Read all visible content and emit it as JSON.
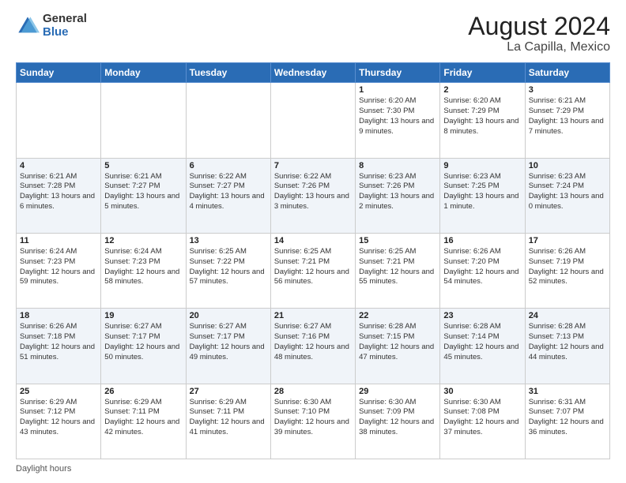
{
  "logo": {
    "general": "General",
    "blue": "Blue"
  },
  "title": {
    "month": "August 2024",
    "location": "La Capilla, Mexico"
  },
  "days_of_week": [
    "Sunday",
    "Monday",
    "Tuesday",
    "Wednesday",
    "Thursday",
    "Friday",
    "Saturday"
  ],
  "footer": {
    "daylight_label": "Daylight hours"
  },
  "weeks": [
    [
      {
        "day": "",
        "info": ""
      },
      {
        "day": "",
        "info": ""
      },
      {
        "day": "",
        "info": ""
      },
      {
        "day": "",
        "info": ""
      },
      {
        "day": "1",
        "info": "Sunrise: 6:20 AM\nSunset: 7:30 PM\nDaylight: 13 hours and 9 minutes."
      },
      {
        "day": "2",
        "info": "Sunrise: 6:20 AM\nSunset: 7:29 PM\nDaylight: 13 hours and 8 minutes."
      },
      {
        "day": "3",
        "info": "Sunrise: 6:21 AM\nSunset: 7:29 PM\nDaylight: 13 hours and 7 minutes."
      }
    ],
    [
      {
        "day": "4",
        "info": "Sunrise: 6:21 AM\nSunset: 7:28 PM\nDaylight: 13 hours and 6 minutes."
      },
      {
        "day": "5",
        "info": "Sunrise: 6:21 AM\nSunset: 7:27 PM\nDaylight: 13 hours and 5 minutes."
      },
      {
        "day": "6",
        "info": "Sunrise: 6:22 AM\nSunset: 7:27 PM\nDaylight: 13 hours and 4 minutes."
      },
      {
        "day": "7",
        "info": "Sunrise: 6:22 AM\nSunset: 7:26 PM\nDaylight: 13 hours and 3 minutes."
      },
      {
        "day": "8",
        "info": "Sunrise: 6:23 AM\nSunset: 7:26 PM\nDaylight: 13 hours and 2 minutes."
      },
      {
        "day": "9",
        "info": "Sunrise: 6:23 AM\nSunset: 7:25 PM\nDaylight: 13 hours and 1 minute."
      },
      {
        "day": "10",
        "info": "Sunrise: 6:23 AM\nSunset: 7:24 PM\nDaylight: 13 hours and 0 minutes."
      }
    ],
    [
      {
        "day": "11",
        "info": "Sunrise: 6:24 AM\nSunset: 7:23 PM\nDaylight: 12 hours and 59 minutes."
      },
      {
        "day": "12",
        "info": "Sunrise: 6:24 AM\nSunset: 7:23 PM\nDaylight: 12 hours and 58 minutes."
      },
      {
        "day": "13",
        "info": "Sunrise: 6:25 AM\nSunset: 7:22 PM\nDaylight: 12 hours and 57 minutes."
      },
      {
        "day": "14",
        "info": "Sunrise: 6:25 AM\nSunset: 7:21 PM\nDaylight: 12 hours and 56 minutes."
      },
      {
        "day": "15",
        "info": "Sunrise: 6:25 AM\nSunset: 7:21 PM\nDaylight: 12 hours and 55 minutes."
      },
      {
        "day": "16",
        "info": "Sunrise: 6:26 AM\nSunset: 7:20 PM\nDaylight: 12 hours and 54 minutes."
      },
      {
        "day": "17",
        "info": "Sunrise: 6:26 AM\nSunset: 7:19 PM\nDaylight: 12 hours and 52 minutes."
      }
    ],
    [
      {
        "day": "18",
        "info": "Sunrise: 6:26 AM\nSunset: 7:18 PM\nDaylight: 12 hours and 51 minutes."
      },
      {
        "day": "19",
        "info": "Sunrise: 6:27 AM\nSunset: 7:17 PM\nDaylight: 12 hours and 50 minutes."
      },
      {
        "day": "20",
        "info": "Sunrise: 6:27 AM\nSunset: 7:17 PM\nDaylight: 12 hours and 49 minutes."
      },
      {
        "day": "21",
        "info": "Sunrise: 6:27 AM\nSunset: 7:16 PM\nDaylight: 12 hours and 48 minutes."
      },
      {
        "day": "22",
        "info": "Sunrise: 6:28 AM\nSunset: 7:15 PM\nDaylight: 12 hours and 47 minutes."
      },
      {
        "day": "23",
        "info": "Sunrise: 6:28 AM\nSunset: 7:14 PM\nDaylight: 12 hours and 45 minutes."
      },
      {
        "day": "24",
        "info": "Sunrise: 6:28 AM\nSunset: 7:13 PM\nDaylight: 12 hours and 44 minutes."
      }
    ],
    [
      {
        "day": "25",
        "info": "Sunrise: 6:29 AM\nSunset: 7:12 PM\nDaylight: 12 hours and 43 minutes."
      },
      {
        "day": "26",
        "info": "Sunrise: 6:29 AM\nSunset: 7:11 PM\nDaylight: 12 hours and 42 minutes."
      },
      {
        "day": "27",
        "info": "Sunrise: 6:29 AM\nSunset: 7:11 PM\nDaylight: 12 hours and 41 minutes."
      },
      {
        "day": "28",
        "info": "Sunrise: 6:30 AM\nSunset: 7:10 PM\nDaylight: 12 hours and 39 minutes."
      },
      {
        "day": "29",
        "info": "Sunrise: 6:30 AM\nSunset: 7:09 PM\nDaylight: 12 hours and 38 minutes."
      },
      {
        "day": "30",
        "info": "Sunrise: 6:30 AM\nSunset: 7:08 PM\nDaylight: 12 hours and 37 minutes."
      },
      {
        "day": "31",
        "info": "Sunrise: 6:31 AM\nSunset: 7:07 PM\nDaylight: 12 hours and 36 minutes."
      }
    ]
  ]
}
